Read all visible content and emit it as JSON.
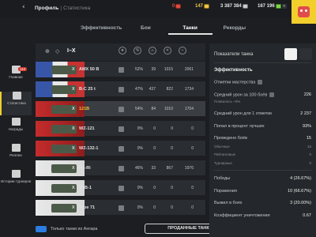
{
  "header": {
    "back_icon": "chevron-left-icon",
    "title": "Профиль",
    "subtitle": "Статистика",
    "red_stat": "0",
    "gold": "147",
    "silver": "3 387 384",
    "free_xp": "167 196"
  },
  "tabs": [
    "Эффективность",
    "Бои",
    "Танки",
    "Рекорды"
  ],
  "sidebar": [
    {
      "label": "Главная",
      "icon": "home-icon",
      "badge": "110"
    },
    {
      "label": "Статистика",
      "icon": "stats-icon"
    },
    {
      "label": "Награды",
      "icon": "awards-icon"
    },
    {
      "label": "Реплеи",
      "icon": "replay-icon"
    },
    {
      "label": "Истории турниров",
      "icon": "trophy-icon"
    }
  ],
  "filter": {
    "tier_range": "I–X",
    "columns": [
      "mastery",
      "win-rate",
      "battles",
      "avg-damage",
      "kills"
    ]
  },
  "tanks": [
    {
      "tier": "X",
      "name": "AMX 50 B",
      "wr": "52%",
      "battles": "39",
      "avg": "1015",
      "max": "2061",
      "gold": false
    },
    {
      "tier": "X",
      "name": "B-C 25 t",
      "wr": "47%",
      "battles": "437",
      "avg": "822",
      "max": "1734",
      "gold": false
    },
    {
      "tier": "X",
      "name": "121B",
      "wr": "54%",
      "battles": "84",
      "avg": "1010",
      "max": "1704",
      "gold": true
    },
    {
      "tier": "X",
      "name": "WZ-121",
      "wr": "0%",
      "battles": "0",
      "avg": "0",
      "max": "0",
      "gold": false
    },
    {
      "tier": "X",
      "name": "WZ-132-1",
      "wr": "0%",
      "battles": "0",
      "avg": "0",
      "max": "0",
      "gold": false
    },
    {
      "tier": "X",
      "name": "Ho-Ri",
      "wr": "46%",
      "battles": "33",
      "avg": "867",
      "max": "1976",
      "gold": false
    },
    {
      "tier": "X",
      "name": "STB-1",
      "wr": "0%",
      "battles": "0",
      "avg": "0",
      "max": "0",
      "gold": false
    },
    {
      "tier": "X",
      "name": "Type 71",
      "wr": "0%",
      "battles": "0",
      "avg": "0",
      "max": "0",
      "gold": false
    }
  ],
  "bottom": {
    "hangar_only": "Только танки из Ангара",
    "sold_tanks": "ПРОДАННЫЕ ТАНКИ"
  },
  "panel": {
    "title": "Показатели танка",
    "section1": "Эффективность",
    "mastery": "Отметки мастерства",
    "avg_dmg_100": "Средний урон за 100 боёв",
    "avg_dmg_100_value": "226",
    "avg_dmg_100_sub": "Появилось ~0%",
    "avg_dmg_1": "Средний урон для 1 отметки",
    "avg_dmg_1_value": "2 237",
    "top_percent": "Попал в процент лучших",
    "top_percent_value": "93%",
    "battles_played": "Проведено боёв",
    "battles_played_value": "15",
    "regular": "Обычные",
    "regular_value": "15",
    "rating": "Рейтинговые",
    "rating_value": "0",
    "tournament": "Турнирные",
    "tournament_value": "0",
    "wins": "Победы",
    "wins_value": "4 (26.67%)",
    "defeats": "Поражения",
    "defeats_value": "10 (66.67%)",
    "survived": "Выжил в боях",
    "survived_value": "3 (20.00%)",
    "kill_ratio": "Коэффициент уничтожения",
    "kill_ratio_value": "0.67"
  }
}
